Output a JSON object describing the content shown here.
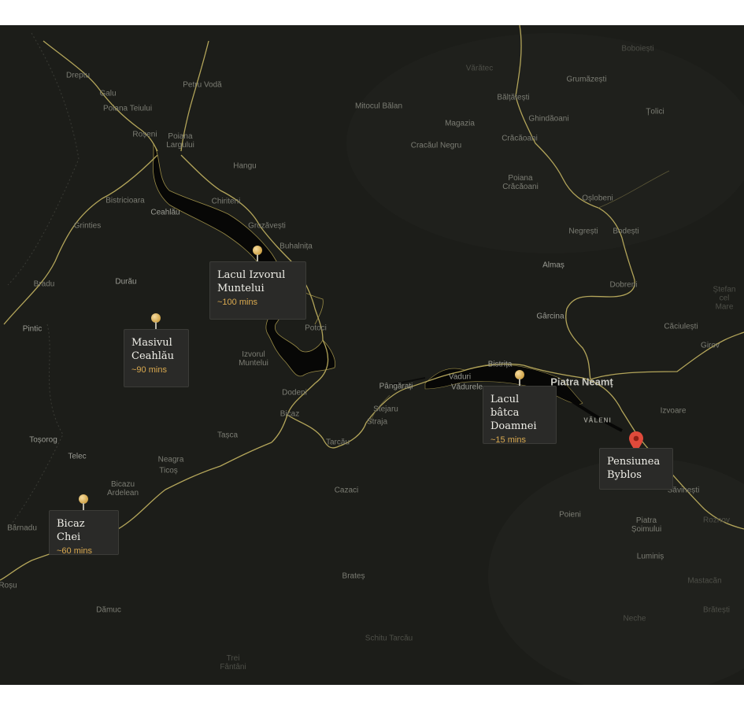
{
  "map": {
    "places": [
      {
        "name": "Dreptu",
        "style": "normal"
      },
      {
        "name": "Galu",
        "style": "normal"
      },
      {
        "name": "Petru Vodă",
        "style": "normal"
      },
      {
        "name": "Poiana Teiului",
        "style": "normal"
      },
      {
        "name": "Roșeni",
        "style": "normal"
      },
      {
        "name": "Poiana\nLargului",
        "style": "normal"
      },
      {
        "name": "Hangu",
        "style": "normal"
      },
      {
        "name": "Mitocul Bălan",
        "style": "normal"
      },
      {
        "name": "Magazia",
        "style": "normal"
      },
      {
        "name": "Cracăul Negru",
        "style": "normal"
      },
      {
        "name": "Vărătec",
        "style": "faint"
      },
      {
        "name": "Bălțătești",
        "style": "normal"
      },
      {
        "name": "Ghindăoani",
        "style": "normal"
      },
      {
        "name": "Crăcăoani",
        "style": "normal"
      },
      {
        "name": "Grumăzești",
        "style": "normal"
      },
      {
        "name": "Țolici",
        "style": "normal"
      },
      {
        "name": "Poiana\nCrăcăoani",
        "style": "normal"
      },
      {
        "name": "Oșlobeni",
        "style": "normal"
      },
      {
        "name": "Negrești",
        "style": "normal"
      },
      {
        "name": "Bodești",
        "style": "normal"
      },
      {
        "name": "Almaș",
        "style": "mid"
      },
      {
        "name": "Dobreni",
        "style": "normal"
      },
      {
        "name": "Gârcina",
        "style": "mid"
      },
      {
        "name": "Căciulești",
        "style": "normal"
      },
      {
        "name": "Girov",
        "style": "normal"
      },
      {
        "name": "Ștefan\ncel Mare",
        "style": "faint"
      },
      {
        "name": "Bistricioara",
        "style": "normal"
      },
      {
        "name": "Ceahlău",
        "style": "mid"
      },
      {
        "name": "Chiriteni",
        "style": "normal"
      },
      {
        "name": "Grozăvești",
        "style": "normal"
      },
      {
        "name": "Buhalnița",
        "style": "normal"
      },
      {
        "name": "Grinties",
        "style": "normal"
      },
      {
        "name": "Bradu",
        "style": "normal"
      },
      {
        "name": "Durău",
        "style": "mid"
      },
      {
        "name": "Pintic",
        "style": "mid"
      },
      {
        "name": "Potoci",
        "style": "normal"
      },
      {
        "name": "Izvorul\nMuntelui",
        "style": "normal"
      },
      {
        "name": "Dodeni",
        "style": "normal"
      },
      {
        "name": "Bicaz",
        "style": "normal"
      },
      {
        "name": "Pângărați",
        "style": "mid"
      },
      {
        "name": "Vaduri",
        "style": "mid"
      },
      {
        "name": "Vădurele",
        "style": "mid"
      },
      {
        "name": "Bistrița",
        "style": "mid"
      },
      {
        "name": "Piatra Neamț",
        "style": "major"
      },
      {
        "name": "Izvoare",
        "style": "normal"
      },
      {
        "name": "VĂLENI",
        "style": "small-caps"
      },
      {
        "name": "Stejaru",
        "style": "normal"
      },
      {
        "name": "Straja",
        "style": "normal"
      },
      {
        "name": "Tarcău",
        "style": "normal"
      },
      {
        "name": "Tașca",
        "style": "normal"
      },
      {
        "name": "Toșorog",
        "style": "mid"
      },
      {
        "name": "Telec",
        "style": "mid"
      },
      {
        "name": "Neagra",
        "style": "normal"
      },
      {
        "name": "Ticoș",
        "style": "normal"
      },
      {
        "name": "Bicazu\nArdelean",
        "style": "normal"
      },
      {
        "name": "Cazaci",
        "style": "normal"
      },
      {
        "name": "Bârnadu",
        "style": "normal"
      },
      {
        "name": "Poieni",
        "style": "normal"
      },
      {
        "name": "Săvinești",
        "style": "normal"
      },
      {
        "name": "Roznov",
        "style": "faint"
      },
      {
        "name": "Piatra\nȘoimului",
        "style": "normal"
      },
      {
        "name": "Luminiș",
        "style": "normal"
      },
      {
        "name": "Mastacăn",
        "style": "faint"
      },
      {
        "name": "Brătești",
        "style": "faint"
      },
      {
        "name": "Brateș",
        "style": "normal"
      },
      {
        "name": "Dămuc",
        "style": "normal"
      },
      {
        "name": "Schitu Tarcău",
        "style": "faint"
      },
      {
        "name": "Neche",
        "style": "faint"
      },
      {
        "name": "Boboiești",
        "style": "faint"
      },
      {
        "name": "Roșu",
        "style": "normal"
      },
      {
        "name": "Trei\nFântâni",
        "style": "faint"
      }
    ]
  },
  "cards": [
    {
      "title": "Lacul Izvorul\nMuntelui",
      "time": "~100 mins"
    },
    {
      "title": "Masivul\nCeahlău",
      "time": "~90 mins"
    },
    {
      "title": "Lacul bâtca\nDoamnei",
      "time": "~15 mins"
    },
    {
      "title": "Bicaz Chei",
      "time": "~60 mins"
    },
    {
      "title": "Pensiunea\nByblos",
      "time": ""
    }
  ],
  "colors": {
    "map_background": "#1c1d19",
    "road": "#b3a55a",
    "water": "#0a0a09",
    "card_background": "#2a2a28",
    "duration_text": "#d9a94f",
    "destination_marker": "#e04a3b"
  },
  "icons": {
    "pin": "gold-pin-icon",
    "destination": "red-map-marker-icon"
  }
}
